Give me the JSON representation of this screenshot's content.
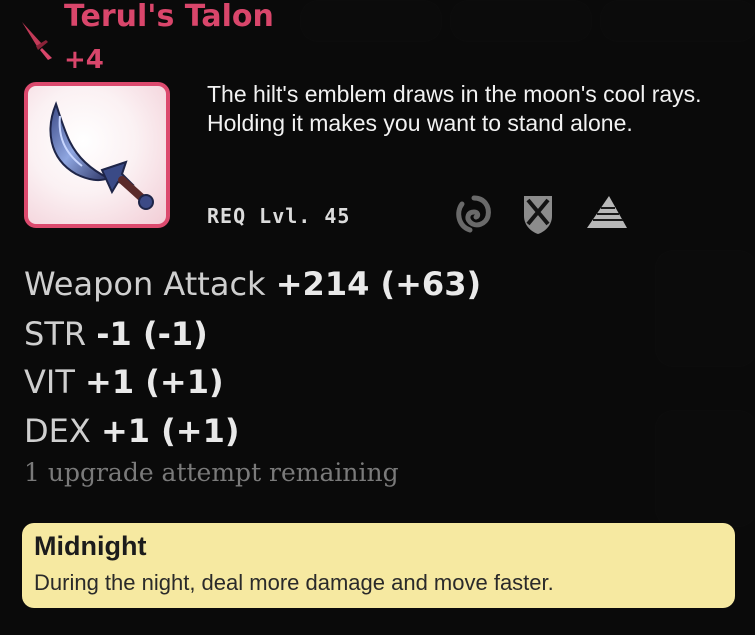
{
  "item": {
    "name": "Terul's Talon",
    "upgrade_level": "+4",
    "description": "The hilt's emblem draws in the moon's cool rays. Holding it makes you want to stand alone.",
    "requirement": "REQ Lvl. 45",
    "element_icons": [
      "swirl-icon",
      "shield-crest-icon",
      "wing-icon"
    ],
    "rarity_color": "#d9466b"
  },
  "stats": [
    {
      "label": "Weapon Attack",
      "value": "+214 (+63)"
    },
    {
      "label": "STR",
      "value": "-1 (-1)"
    },
    {
      "label": "VIT",
      "value": "+1 (+1)"
    },
    {
      "label": "DEX",
      "value": "+1 (+1)"
    }
  ],
  "upgrades_remaining": "1 upgrade attempt remaining",
  "passive": {
    "name": "Midnight",
    "description": "During the night, deal more damage and move faster.",
    "color": "#f6e9a1"
  }
}
